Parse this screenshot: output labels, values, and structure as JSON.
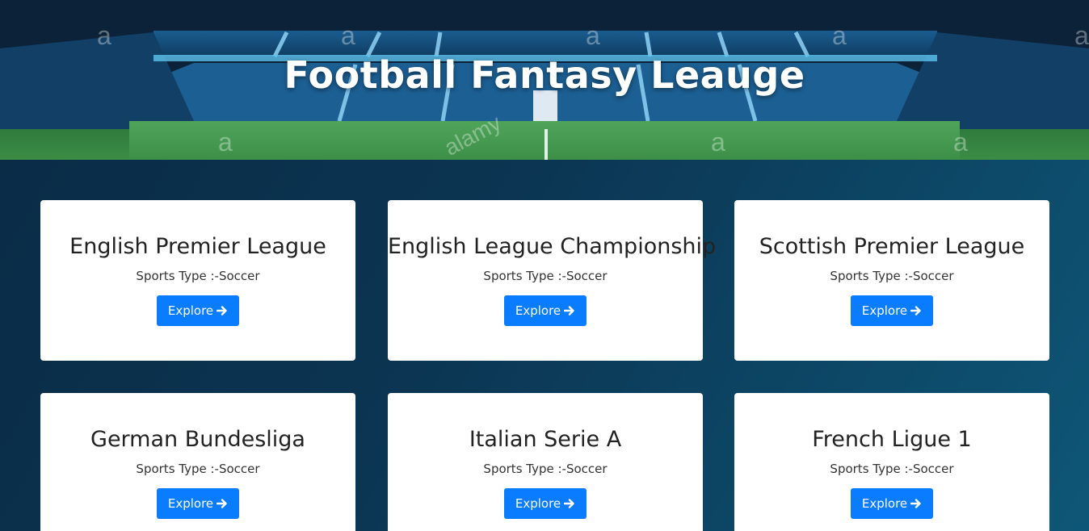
{
  "banner": {
    "title": "Football Fantasy Leauge",
    "watermark_letter": "a",
    "watermark_word": "alamy"
  },
  "cards": [
    {
      "title": "English Premier League",
      "sport_type": "Sports Type :-Soccer",
      "button_label": "Explore",
      "button_icon": "arrow-right-icon"
    },
    {
      "title": "English League Championship",
      "sport_type": "Sports Type :-Soccer",
      "button_label": "Explore",
      "button_icon": "arrow-right-icon"
    },
    {
      "title": "Scottish Premier League",
      "sport_type": "Sports Type :-Soccer",
      "button_label": "Explore",
      "button_icon": "arrow-right-icon"
    },
    {
      "title": "German Bundesliga",
      "sport_type": "Sports Type :-Soccer",
      "button_label": "Explore",
      "button_icon": "arrow-right-icon"
    },
    {
      "title": "Italian Serie A",
      "sport_type": "Sports Type :-Soccer",
      "button_label": "Explore",
      "button_icon": "arrow-right-icon"
    },
    {
      "title": "French Ligue 1",
      "sport_type": "Sports Type :-Soccer",
      "button_label": "Explore",
      "button_icon": "arrow-right-icon"
    }
  ],
  "colors": {
    "button": "#0a7cff",
    "page_background": "#0b3552",
    "card": "#ffffff"
  }
}
